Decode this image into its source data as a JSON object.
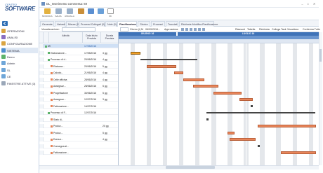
{
  "app": {
    "logo_small": "CENTRO",
    "logo_big": "SOFTWARE",
    "window_title": "DL_Inserimento commessa: 69"
  },
  "sidebar": {
    "items": [
      {
        "label": "OPERAZIONI",
        "color": "#d9a441"
      },
      {
        "label": "ANALISI",
        "color": "#8a6fc1"
      },
      {
        "label": "CONFIGURAZIONE",
        "color": "#d9a441"
      },
      {
        "label": "SISTEMA",
        "color": "#4e8fcf"
      },
      {
        "label": "Demo",
        "color": "#5db36b"
      },
      {
        "label": "Admin",
        "color": "#6fa6d8"
      },
      {
        "label": "SL",
        "color": "#6fa6d8"
      },
      {
        "label": "CE",
        "color": "#6fa6d8"
      },
      {
        "label": "FINESTRE ATTIVE (3)",
        "color": "#9aa7b8"
      }
    ]
  },
  "ribbon": {
    "buttons": [
      {
        "label": "MODIFICA",
        "color": "#e3b13f"
      },
      {
        "label": "SALVA",
        "color": "#9ab0c9"
      },
      {
        "label": "ANNULLA",
        "color": "#9ab0c9"
      },
      {
        "label": "",
        "color": "#c98f3a"
      },
      {
        "label": "",
        "color": "#5b8fd1"
      },
      {
        "label": "",
        "color": "#6aa0d8"
      },
      {
        "label": "69",
        "color": "#ffffff"
      }
    ]
  },
  "tabs": [
    "Generale",
    "Varianti",
    "Misure (0)",
    "Processi Collegati (0)",
    "Note (0)",
    "Pianificazione",
    "Storico",
    "Processi",
    "Tracciati",
    "Richieste Modifica Pianificazione"
  ],
  "active_tab": "Pianificazione",
  "toolbar": {
    "view_label": "Visualizzazione:",
    "zoom_label": "Giorno (i) M",
    "date_value": "06/09/2016...",
    "approx_label": "Approssima:",
    "right_items": [
      "Riassunt",
      "Tabella",
      "Richiesta",
      "Collega Task",
      "Visualizza",
      "Conferma Tutto"
    ]
  },
  "grid": {
    "columns": [
      "Attività",
      "Data Inizio Prevista",
      "Durata Prevista"
    ],
    "rows": [
      {
        "num": "",
        "name": "69",
        "start": "17/05/2016",
        "dur": "",
        "indent": 0,
        "color": "#5db36b",
        "selected": true
      },
      {
        "num": "",
        "name": "Elaborazione...",
        "start": "17/05/2016",
        "dur": "3 gg",
        "indent": 1,
        "color": "#5db36b"
      },
      {
        "num": "",
        "name": "Processo di d...",
        "start": "20/06/2016",
        "dur": "4 gg",
        "indent": 1,
        "color": "#5db36b"
      },
      {
        "num": "",
        "name": "Elaboraz...",
        "start": "20/06/2016",
        "dur": "5 gg",
        "indent": 2,
        "color": "#e8855a"
      },
      {
        "num": "",
        "name": "Calcolo...",
        "start": "21/06/2016",
        "dur": "4 gg",
        "indent": 2,
        "color": "#e8855a"
      },
      {
        "num": "",
        "name": "Celle officina",
        "start": "28/06/2016",
        "dur": "4 gg",
        "indent": 2,
        "color": "#e8855a"
      },
      {
        "num": "",
        "name": "Assegnaz...",
        "start": "28/06/2016",
        "dur": "5 gg",
        "indent": 2,
        "color": "#e8855a"
      },
      {
        "num": "",
        "name": "Progettazione",
        "start": "30/06/2016",
        "dur": "5 gg",
        "indent": 2,
        "color": "#e8855a"
      },
      {
        "num": "",
        "name": "Assegnaz...",
        "start": "12/07/2016",
        "dur": "3 gg",
        "indent": 2,
        "color": "#e8855a"
      },
      {
        "num": "",
        "name": "Fatturazione...",
        "start": "14/07/2016",
        "dur": "",
        "indent": 2,
        "color": "#e8855a"
      },
      {
        "num": "",
        "name": "Processo di F...",
        "start": "12/07/2016",
        "dur": "",
        "indent": 1,
        "color": "#5db36b"
      },
      {
        "num": "",
        "name": "Stato di...",
        "start": "",
        "dur": "",
        "indent": 2,
        "color": "#e8855a"
      },
      {
        "num": "",
        "name": "Produz...",
        "start": "",
        "dur": "20 gg",
        "indent": 2,
        "color": "#e8855a"
      },
      {
        "num": "",
        "name": "Produz...",
        "start": "",
        "dur": "5 gg",
        "indent": 2,
        "color": "#e8855a"
      },
      {
        "num": "",
        "name": "Esecuz...",
        "start": "",
        "dur": "4 gg",
        "indent": 2,
        "color": "#e8855a"
      },
      {
        "num": "",
        "name": "Consegna al...",
        "start": "",
        "dur": "",
        "indent": 2,
        "color": "#e8855a"
      },
      {
        "num": "",
        "name": "Fatturazione...",
        "start": "",
        "dur": "",
        "indent": 2,
        "color": "#e8855a"
      }
    ]
  },
  "gantt": {
    "months": [
      "GIUGNO 16",
      "LUGLIO 16"
    ],
    "bars": [
      {
        "row": 1,
        "start": 5,
        "end": 9.5,
        "kind": "highlight"
      },
      {
        "row": 2,
        "start": 9.5,
        "end": 34,
        "kind": "summary"
      },
      {
        "row": 3,
        "start": 12,
        "end": 25,
        "kind": "task"
      },
      {
        "row": 4,
        "start": 24,
        "end": 28,
        "kind": "task"
      },
      {
        "row": 5,
        "start": 28,
        "end": 37,
        "kind": "task"
      },
      {
        "row": 6,
        "start": 32,
        "end": 43,
        "kind": "task"
      },
      {
        "row": 7,
        "start": 41,
        "end": 53,
        "kind": "task"
      },
      {
        "row": 8,
        "start": 52,
        "end": 58,
        "kind": "task"
      },
      {
        "row": 9,
        "start": 57,
        "end": 59,
        "kind": "milestone"
      },
      {
        "row": 10,
        "start": 38,
        "end": 85,
        "kind": "summary"
      },
      {
        "row": 11,
        "start": 38,
        "end": 39,
        "kind": "milestone"
      },
      {
        "row": 12,
        "start": 60,
        "end": 85,
        "kind": "task"
      },
      {
        "row": 13,
        "start": 47,
        "end": 50,
        "kind": "task"
      },
      {
        "row": 14,
        "start": 48,
        "end": 59,
        "kind": "task"
      },
      {
        "row": 15,
        "start": 60,
        "end": 61,
        "kind": "milestone"
      },
      {
        "row": 16,
        "start": 70,
        "end": 85,
        "kind": "task"
      }
    ]
  }
}
